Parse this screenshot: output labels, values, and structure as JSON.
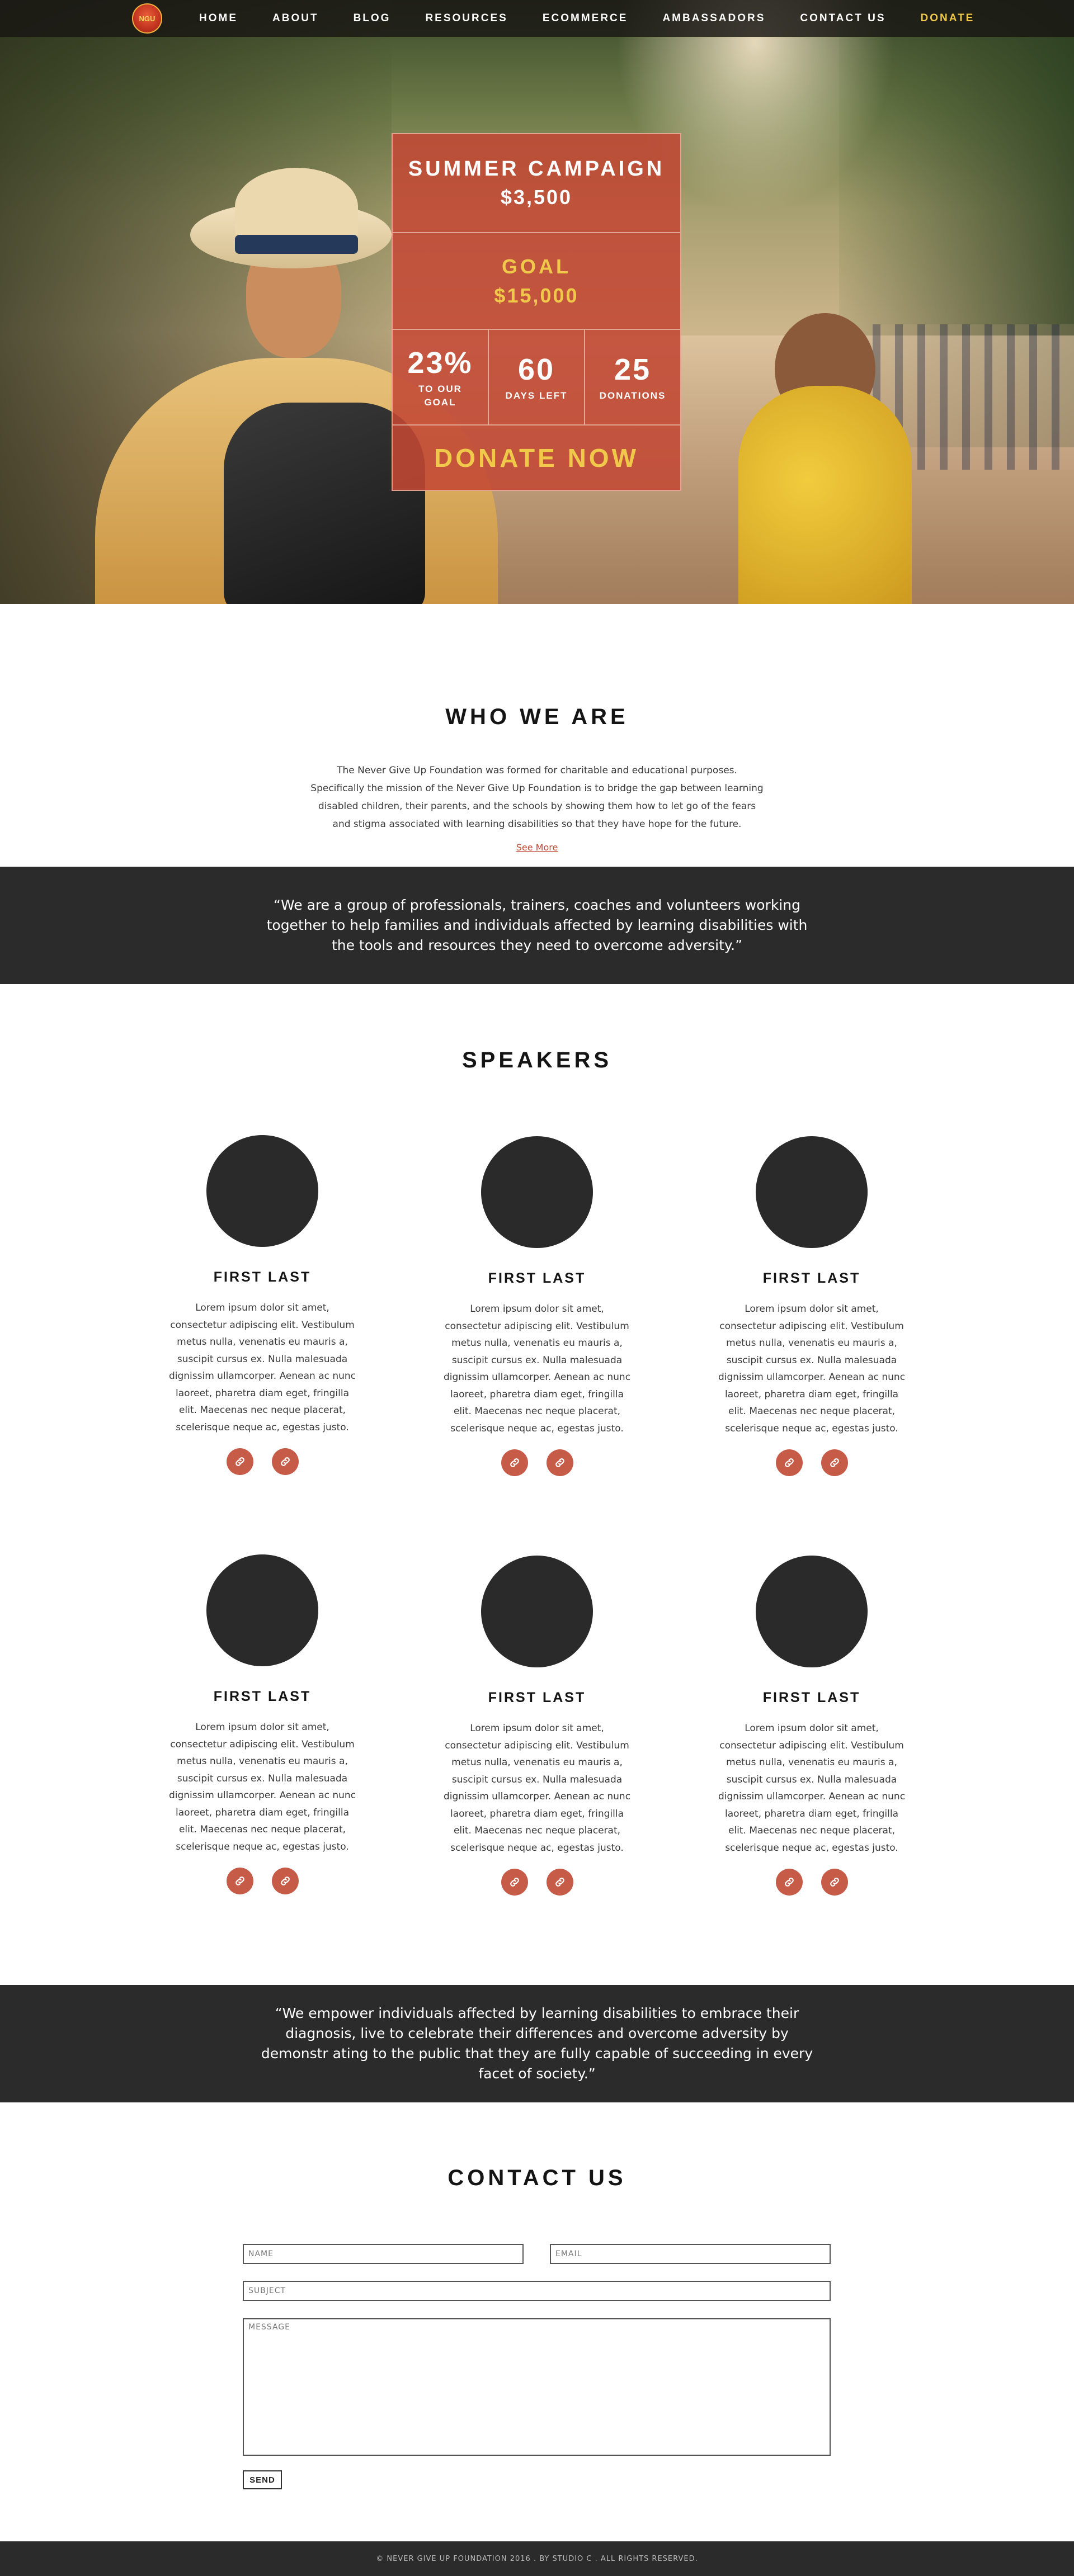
{
  "nav": {
    "logo_alt": "NGU",
    "items": [
      "HOME",
      "ABOUT",
      "BLOG",
      "RESOURCES",
      "ECOMMERCE",
      "AMBASSADORS",
      "CONTACT US",
      "DONATE"
    ]
  },
  "campaign": {
    "title": "SUMMER CAMPAIGN",
    "raised": "$3,500",
    "goal_label": "GOAL",
    "goal_amount": "$15,000",
    "stats": [
      {
        "value": "23%",
        "label": "TO OUR GOAL"
      },
      {
        "value": "60",
        "label": "DAYS LEFT"
      },
      {
        "value": "25",
        "label": "DONATIONS"
      }
    ],
    "donate_label": "DONATE NOW"
  },
  "who": {
    "title": "WHO WE ARE",
    "text": "The Never Give Up Foundation was formed for charitable and educational purposes. Specifically the mission of the Never Give Up Foundation is to bridge the gap between learning disabled children, their parents, and the schools by showing them how to let go of the fears and stigma associated with learning disabilities so that they have hope for the future.",
    "see_more": "See More"
  },
  "quote1": "“We are a group of professionals, trainers, coaches and volunteers working together to help families and individuals affected by learning disabilities with the tools and resources they need to overcome adversity.”",
  "speakers": {
    "title": "SPEAKERS",
    "items": [
      {
        "name": "FIRST LAST",
        "bio": "Lorem ipsum dolor sit amet, consectetur adipiscing elit. Vestibulum metus nulla, venenatis eu mauris a, suscipit cursus ex. Nulla malesuada dignissim ullamcorper. Aenean ac nunc laoreet, pharetra diam eget, fringilla elit. Maecenas nec neque placerat, scelerisque neque ac, egestas justo."
      },
      {
        "name": "FIRST LAST",
        "bio": "Lorem ipsum dolor sit amet, consectetur adipiscing elit. Vestibulum metus nulla, venenatis eu mauris a, suscipit cursus ex. Nulla malesuada dignissim ullamcorper. Aenean ac nunc laoreet, pharetra diam eget, fringilla elit. Maecenas nec neque placerat, scelerisque neque ac, egestas justo."
      },
      {
        "name": "FIRST LAST",
        "bio": "Lorem ipsum dolor sit amet, consectetur adipiscing elit. Vestibulum metus nulla, venenatis eu mauris a, suscipit cursus ex. Nulla malesuada dignissim ullamcorper. Aenean ac nunc laoreet, pharetra diam eget, fringilla elit. Maecenas nec neque placerat, scelerisque neque ac, egestas justo."
      },
      {
        "name": "FIRST LAST",
        "bio": "Lorem ipsum dolor sit amet, consectetur adipiscing elit. Vestibulum metus nulla, venenatis eu mauris a, suscipit cursus ex. Nulla malesuada dignissim ullamcorper. Aenean ac nunc laoreet, pharetra diam eget, fringilla elit. Maecenas nec neque placerat, scelerisque neque ac, egestas justo."
      },
      {
        "name": "FIRST LAST",
        "bio": "Lorem ipsum dolor sit amet, consectetur adipiscing elit. Vestibulum metus nulla, venenatis eu mauris a, suscipit cursus ex. Nulla malesuada dignissim ullamcorper. Aenean ac nunc laoreet, pharetra diam eget, fringilla elit. Maecenas nec neque placerat, scelerisque neque ac, egestas justo."
      },
      {
        "name": "FIRST LAST",
        "bio": "Lorem ipsum dolor sit amet, consectetur adipiscing elit. Vestibulum metus nulla, venenatis eu mauris a, suscipit cursus ex. Nulla malesuada dignissim ullamcorper. Aenean ac nunc laoreet, pharetra diam eget, fringilla elit. Maecenas nec neque placerat, scelerisque neque ac, egestas justo."
      }
    ]
  },
  "quote2": "“We empower individuals affected by learning disabilities to embrace their diagnosis, live to celebrate their differences and overcome adversity by demonstr ating to the public that they are fully capable of succeeding in every facet of society.”",
  "contact": {
    "title": "CONTACT US",
    "name_placeholder": "NAME",
    "email_placeholder": "EMAIL",
    "subject_placeholder": "SUBJECT",
    "message_placeholder": "MESSAGE",
    "send_label": "SEND"
  },
  "footer": "© NEVER GIVE UP FOUNDATION 2016 . BY STUDIO C . ALL RIGHTS RESERVED.",
  "colors": {
    "accent": "#c14834",
    "gold": "#f0c94a",
    "dark_band": "#2b2b2b"
  },
  "icons": {
    "speaker_link": "link-icon"
  }
}
